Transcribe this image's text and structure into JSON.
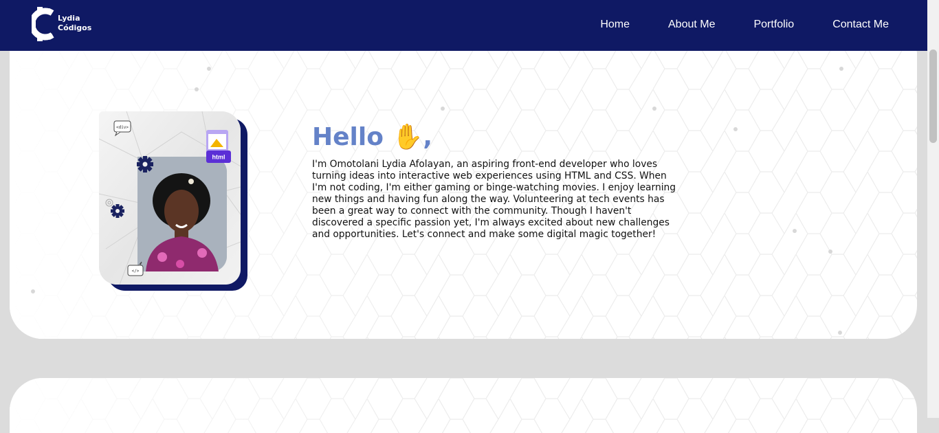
{
  "logo": {
    "line1": "Lydia",
    "line2": "Códigos"
  },
  "nav": {
    "home": "Home",
    "about": "About Me",
    "portfolio": "Portfolio",
    "contact": "Contact Me"
  },
  "hero": {
    "greeting": "Hello",
    "wave_emoji": "✋",
    "comma": ",",
    "bio": "I'm Omotolani Lydia Afolayan, an aspiring front-end developer who loves turning ideas into interactive web experiences using HTML and CSS. When I'm not coding, I'm either gaming or binge-watching movies. I enjoy learning new things and having fun along the way. Volunteering at tech events has been a great way to connect with the community. Though I haven't discovered a specific passion yet, I'm always excited about new challenges and opportunities. Let's connect and make some digital magic together!",
    "div_tag": "<div>",
    "html_badge": "html",
    "code_tag": "</>"
  },
  "colors": {
    "navbar": "#0f1964",
    "greeting": "#6482c8",
    "photo_frame_shadow": "#0f1964",
    "html_badge": "#5b2fd6"
  }
}
